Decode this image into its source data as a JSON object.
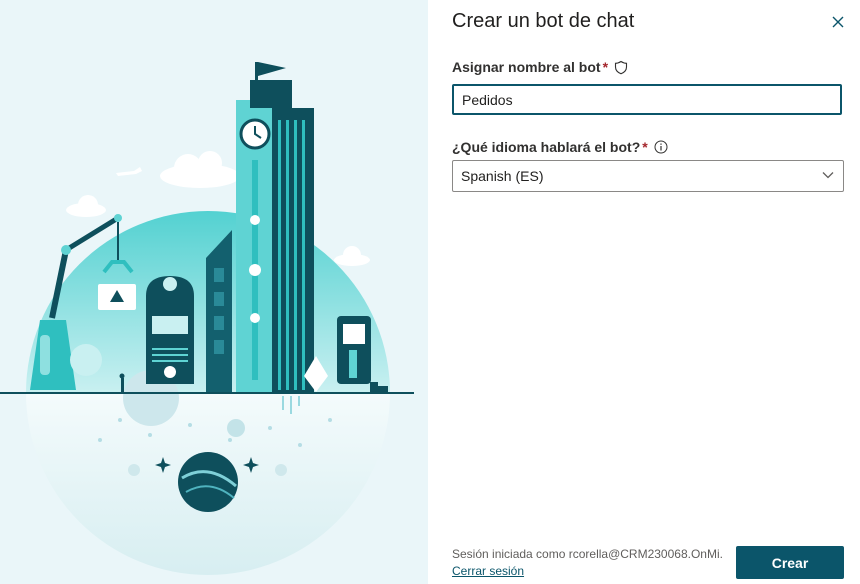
{
  "dialog": {
    "title": "Crear un bot de chat",
    "close_icon": "close-icon"
  },
  "form": {
    "name_label": "Asignar nombre al bot",
    "name_required": "*",
    "name_icon": "shield-icon",
    "name_value": "Pedidos",
    "language_label": "¿Qué idioma hablará el bot?",
    "language_required": "*",
    "language_icon": "info-icon",
    "language_value": "Spanish (ES)"
  },
  "footer": {
    "signed_in_text": "Sesión iniciada como rcorella@CRM230068.OnMi...",
    "sign_out_label": "Cerrar sesión",
    "create_label": "Crear"
  },
  "colors": {
    "accent": "#0b556a",
    "illustration_bg": "#eaf6f9",
    "teal_light": "#5fd3d3",
    "teal_dark": "#0e4f5c",
    "required": "#a4262c"
  }
}
